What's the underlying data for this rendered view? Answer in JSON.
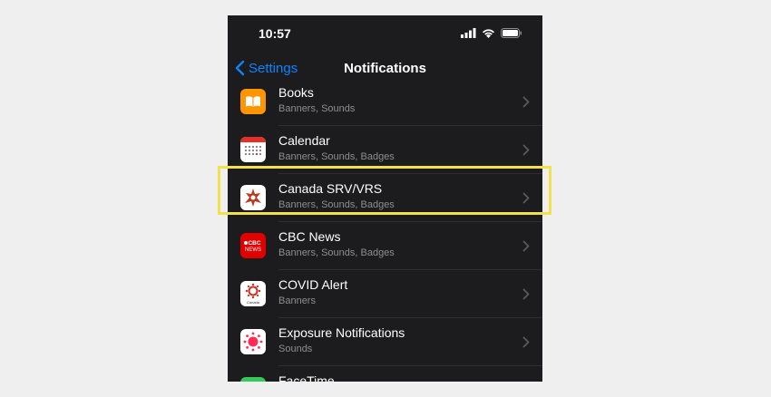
{
  "status_bar": {
    "time": "10:57"
  },
  "nav": {
    "back_label": "Settings",
    "title": "Notifications"
  },
  "rows": [
    {
      "name": "Books",
      "subtitle": "Banners, Sounds",
      "icon": "books-icon",
      "color": "#ff9500"
    },
    {
      "name": "Calendar",
      "subtitle": "Banners, Sounds, Badges",
      "icon": "calendar-icon",
      "color": "#ffffff"
    },
    {
      "name": "Canada SRV/VRS",
      "subtitle": "Banners, Sounds, Badges",
      "icon": "canada-srv-vrs-icon",
      "color": "#ffffff",
      "highlighted": true
    },
    {
      "name": "CBC News",
      "subtitle": "Banners, Sounds, Badges",
      "icon": "cbc-news-icon",
      "color": "#e00000",
      "icon_text": "CBC NEWS"
    },
    {
      "name": "COVID Alert",
      "subtitle": "Banners",
      "icon": "covid-alert-icon",
      "color": "#ffffff",
      "icon_text": "Canada"
    },
    {
      "name": "Exposure Notifications",
      "subtitle": "Sounds",
      "icon": "exposure-notifications-icon",
      "color": "#ffffff"
    },
    {
      "name": "FaceTime",
      "subtitle": "",
      "icon": "facetime-icon",
      "color": "#34c759"
    }
  ],
  "highlight_color": "#f2e14c"
}
